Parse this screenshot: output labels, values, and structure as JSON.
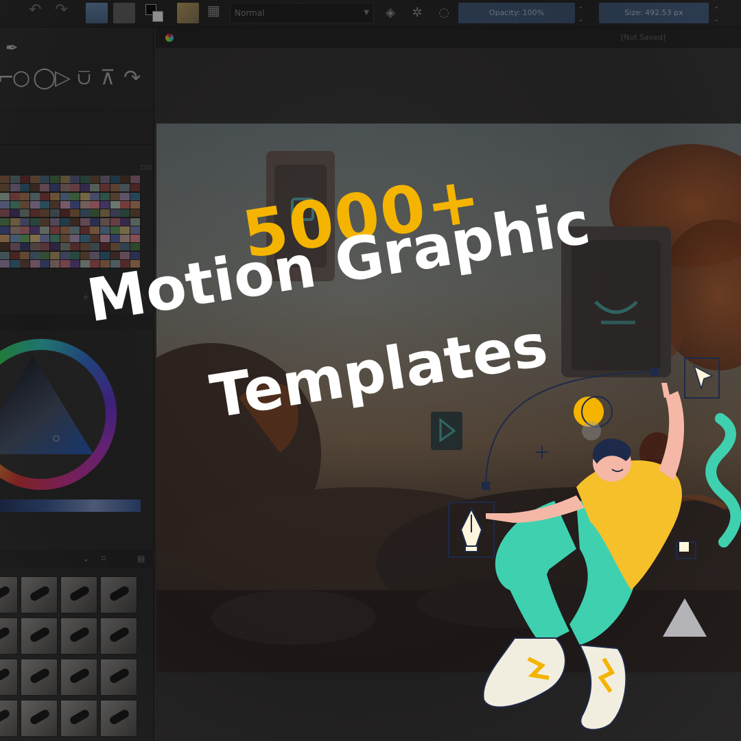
{
  "toolbar": {
    "blend_mode": "Normal",
    "opacity_label": "Opacity: 100%",
    "size_label": "Size: 492.53 px"
  },
  "document": {
    "title": "[Not Saved]"
  },
  "headline": {
    "count": "5000+",
    "line1": "Motion Graphic",
    "line2": "Templates"
  },
  "colors": {
    "accent_yellow": "#f4b400",
    "headline_white": "#ffffff",
    "character_teal": "#3fd0b0",
    "character_shirt": "#f5c02a"
  },
  "icons": {
    "undo": "undo-icon",
    "redo": "redo-icon",
    "cursor": "cursor-arrow-icon",
    "pen": "pen-nib-icon"
  }
}
